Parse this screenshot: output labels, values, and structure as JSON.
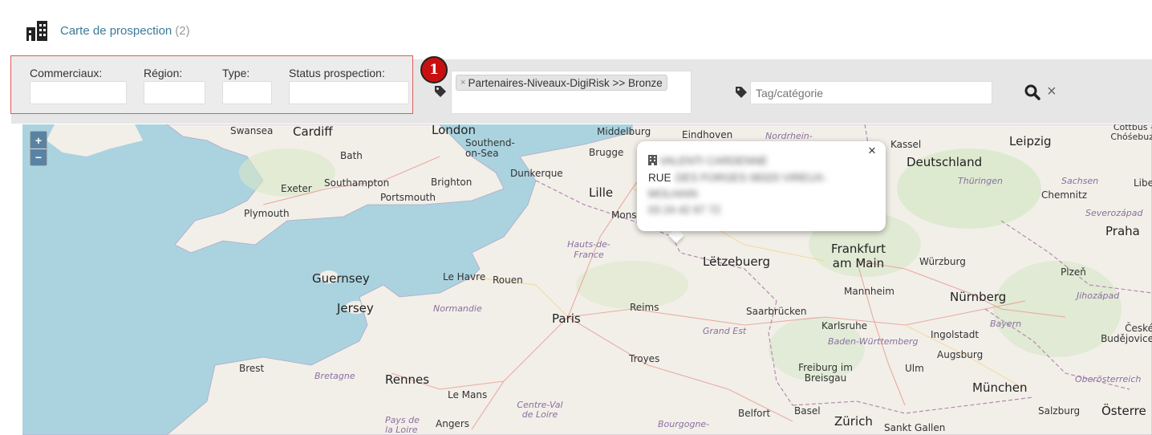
{
  "header": {
    "title": "Carte de prospection",
    "count": "(2)",
    "icon": "buildings-icon"
  },
  "filters": {
    "commerciaux_label": "Commerciaux:",
    "region_label": "Région:",
    "type_label": "Type:",
    "status_label": "Status prospection:"
  },
  "annotation": {
    "badge": "1",
    "color": "#c81010"
  },
  "tags": {
    "selected_chip": "Partenaires-Niveaux-DigiRisk >> Bronze",
    "chip_remove": "×",
    "category_placeholder": "Tag/catégorie"
  },
  "actions": {
    "search_icon": "search-icon",
    "clear_symbol": "×"
  },
  "map": {
    "zoom_in": "+",
    "zoom_out": "−",
    "labels": {
      "swansea": "Swansea",
      "cardiff": "Cardiff",
      "london": "London",
      "southend": "Southend-on-Sea",
      "bath": "Bath",
      "exeter": "Exeter",
      "southampton": "Southampton",
      "brighton": "Brighton",
      "portsmouth": "Portsmouth",
      "plymouth": "Plymouth",
      "middelburg": "Middelburg",
      "brugge": "Brugge",
      "dunkerque": "Dunkerque",
      "lille": "Lille",
      "mons": "Mons",
      "eindhoven": "Eindhoven",
      "kassel": "Kassel",
      "leipzig": "Leipzig",
      "cottbus": "Cottbus - Chóśebuz",
      "deutschland": "Deutschland",
      "thuringen": "Thüringen",
      "sachsen": "Sachsen",
      "chemnitz": "Chemnitz",
      "liberec": "Libe",
      "severozapad": "Severozápad",
      "praha": "Praha",
      "hauts": "Hauts-de-France",
      "letzebuerg": "Lëtzebuerg",
      "frankfurt": "Frankfurt am Main",
      "wurzburg": "Würzburg",
      "plzen": "Plzeň",
      "guernsey": "Guernsey",
      "lehavre": "Le Havre",
      "rouen": "Rouen",
      "mannheim": "Mannheim",
      "nurnberg": "Nürnberg",
      "jihozapad": "Jihozápad",
      "jersey": "Jersey",
      "normandie": "Normandie",
      "reims": "Reims",
      "saarbrucken": "Saarbrücken",
      "paris": "Paris",
      "karlsruhe": "Karlsruhe",
      "bayern": "Bayern",
      "grandest": "Grand Est",
      "ingolstadt": "Ingolstadt",
      "ceske": "České Budějovice",
      "badenw": "Baden-Württemberg",
      "augsburg": "Augsburg",
      "troyes": "Troyes",
      "brest": "Brest",
      "bretagne": "Bretagne",
      "rennes": "Rennes",
      "freiburg": "Freiburg im Breisgau",
      "ulm": "Ulm",
      "oberosterreich": "Oberösterreich",
      "munchen": "München",
      "lemans": "Le Mans",
      "centre": "Centre-Val de Loire",
      "pays": "Pays de la Loire",
      "angers": "Angers",
      "bourgogne": "Bourgogne-",
      "belfort": "Belfort",
      "basel": "Basel",
      "zurich": "Zürich",
      "sanktgallen": "Sankt Gallen",
      "salzburg": "Salzburg",
      "osterreich": "Österre",
      "nordrhein": "Nordrhein-"
    }
  },
  "popup": {
    "close": "×",
    "icon": "building-icon",
    "name": "VALENTI CARDENNE",
    "address_start": "RUE",
    "address_blur": "DES FORGES 08320 VIREUX-",
    "address_cont": "MOLHAIN",
    "phone": "03 24 42 67 72"
  }
}
